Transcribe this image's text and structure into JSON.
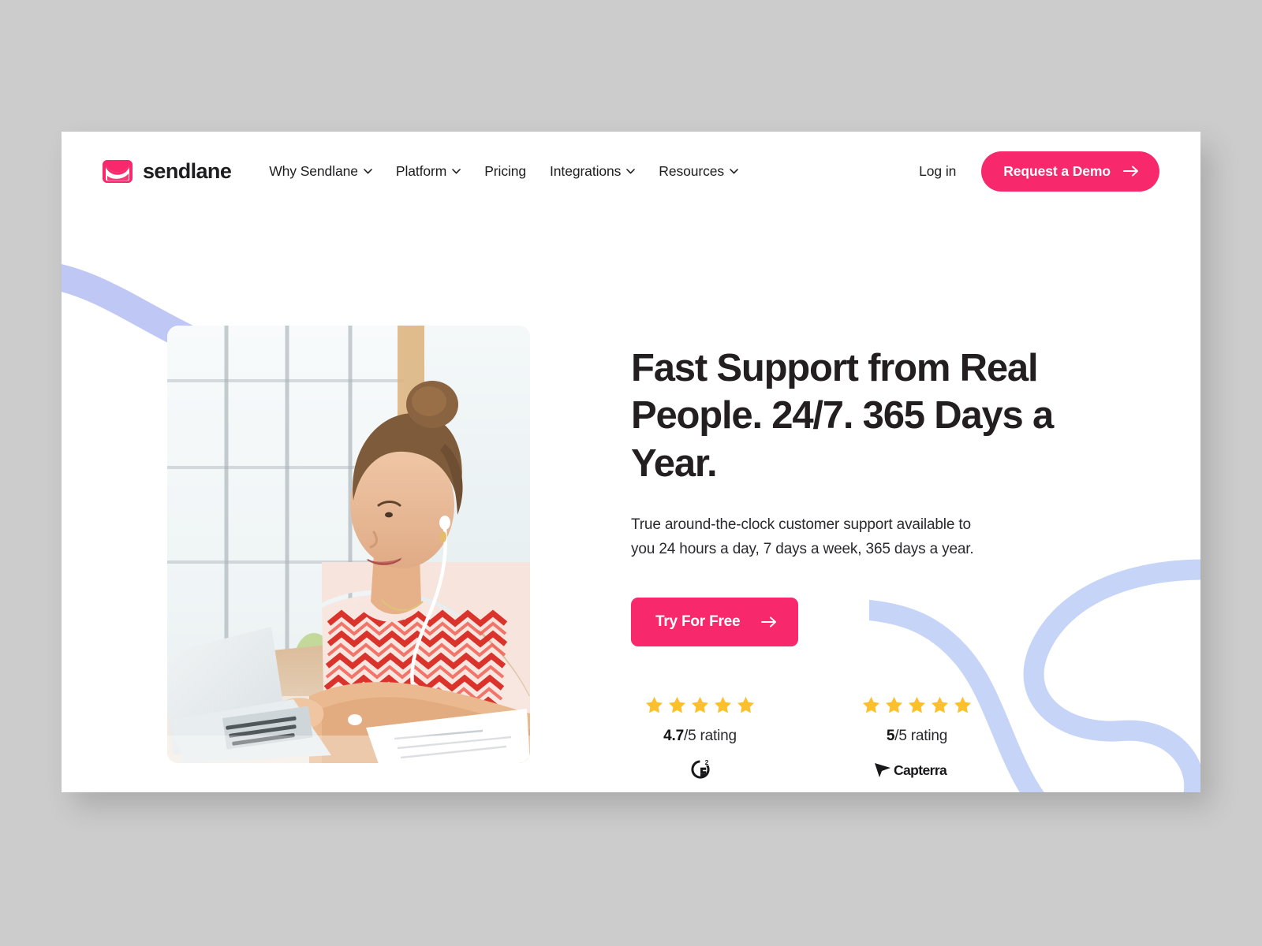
{
  "theme": {
    "page_background": "#cccccc",
    "card_background": "#ffffff",
    "brand_pink": "#f7286b",
    "text_dark": "#231f20",
    "star_yellow": "#fcc02c",
    "decor_periwinkle": "#aab4f2",
    "decor_blue_light": "#c2d2f7"
  },
  "header": {
    "logo": {
      "icon": "sendlane-envelope-icon",
      "name": "sendlane"
    },
    "nav": [
      {
        "label": "Why Sendlane",
        "has_dropdown": true,
        "icon": "chevron-down-icon"
      },
      {
        "label": "Platform",
        "has_dropdown": true,
        "icon": "chevron-down-icon"
      },
      {
        "label": "Pricing",
        "has_dropdown": false
      },
      {
        "label": "Integrations",
        "has_dropdown": true,
        "icon": "chevron-down-icon"
      },
      {
        "label": "Resources",
        "has_dropdown": true,
        "icon": "chevron-down-icon"
      }
    ],
    "login_label": "Log in",
    "demo_button": {
      "label": "Request a Demo",
      "icon": "arrow-right-icon"
    }
  },
  "hero": {
    "image_alt": "Woman with earphones smiling while working on a laptop at a desk near a window",
    "headline": "Fast Support from Real People. 24/7. 365 Days a Year.",
    "subcopy": "True around-the-clock customer support available to you 24 hours a day, 7 days a week, 365 days a year.",
    "cta": {
      "label": "Try For Free",
      "icon": "arrow-right-icon"
    },
    "ratings": [
      {
        "stars": 5,
        "score": "4.7",
        "score_suffix": "/5 rating",
        "source": "G2",
        "source_icon": "g2-logo-icon"
      },
      {
        "stars": 5,
        "score": "5",
        "score_suffix": "/5 rating",
        "source": "Capterra",
        "source_icon": "capterra-logo-icon"
      }
    ]
  },
  "decorations": {
    "left_ribbon": "periwinkle-curve-ribbon",
    "right_ribbon": "periwinkle-loop-ribbon",
    "dot_grid": "periwinkle-dot-grid"
  }
}
